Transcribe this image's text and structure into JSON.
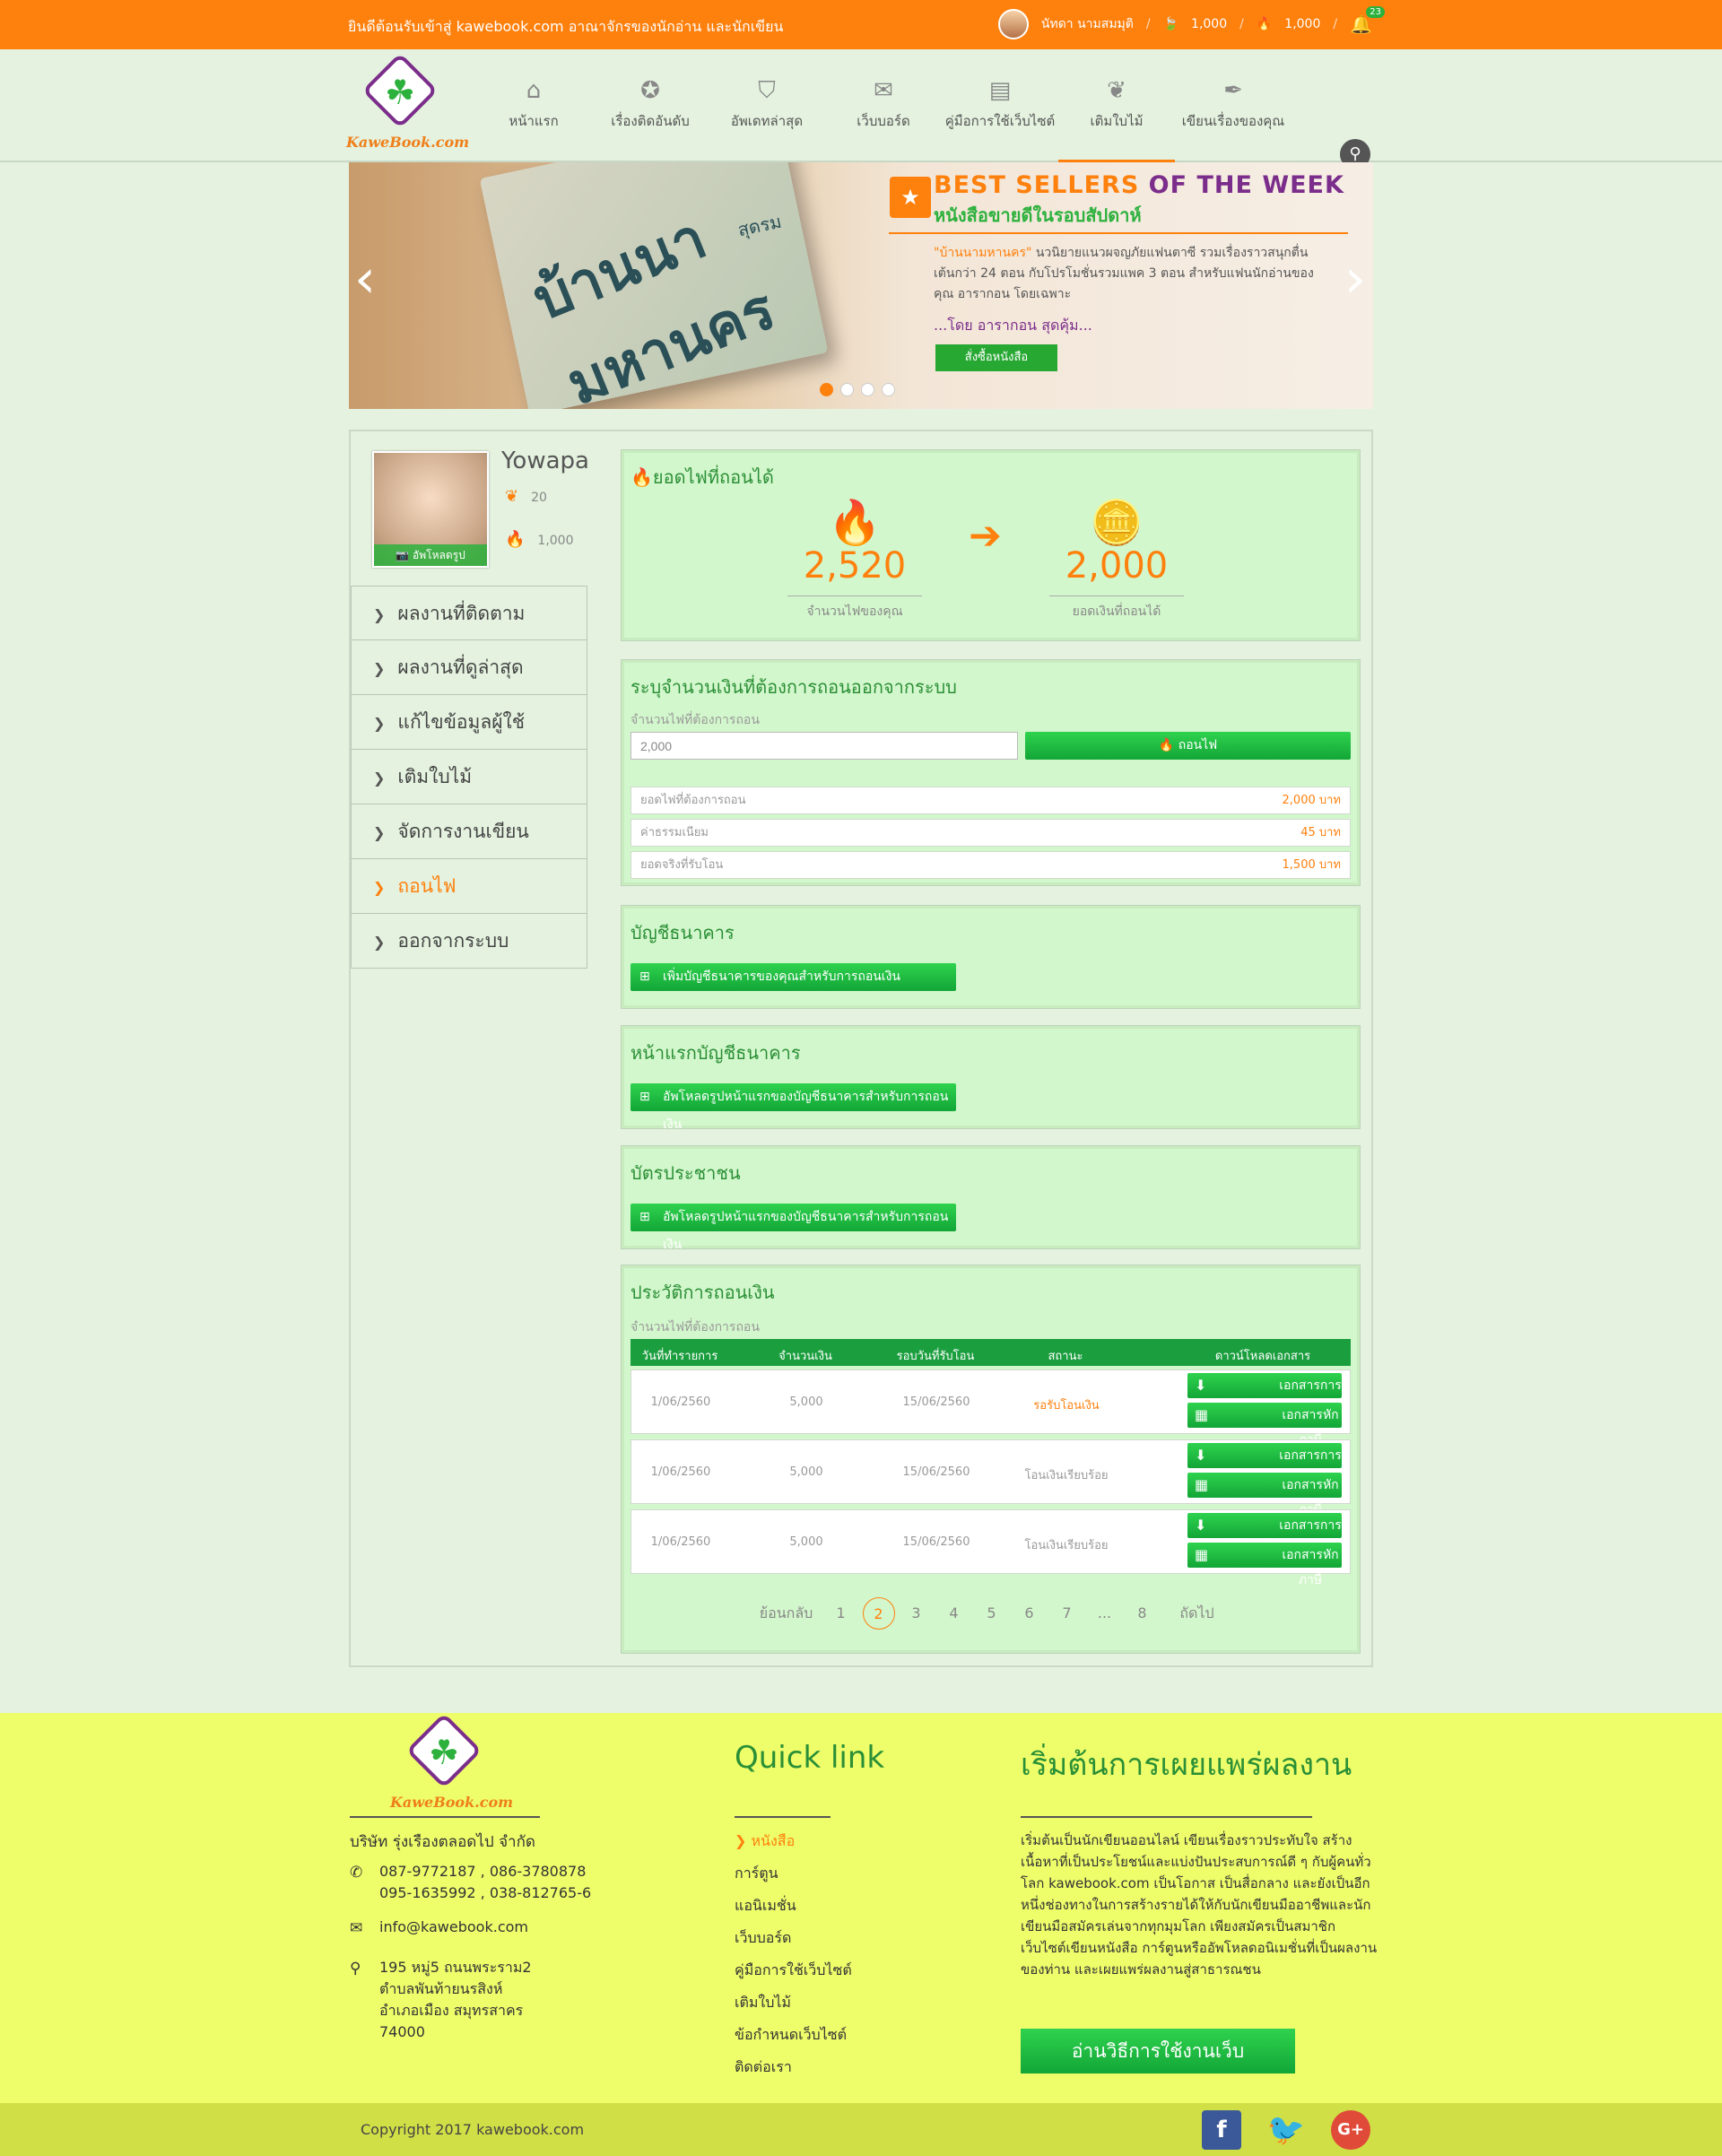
{
  "topbar": {
    "welcome": "ยินดีต้อนรับเข้าสู่ kawebook.com อาณาจักรของนักอ่าน และนักเขียน",
    "user": "นัทดา นามสมมุติ",
    "leaves": "1,000",
    "fire": "1,000",
    "notifications": "23"
  },
  "nav": {
    "logo": "KaweBook.com",
    "items": [
      {
        "label": "หน้าแรก",
        "icon": "home-icon"
      },
      {
        "label": "เรื่องติดอันดับ",
        "icon": "ribbon-icon"
      },
      {
        "label": "อัพเดทล่าสุด",
        "icon": "shield-icon"
      },
      {
        "label": "เว็บบอร์ด",
        "icon": "chat-icon"
      },
      {
        "label": "คู่มือการใช้เว็บไซต์",
        "icon": "book-icon"
      },
      {
        "label": "เติมใบไม้",
        "icon": "leaf-icon"
      },
      {
        "label": "เขียนเรื่องของคุณ",
        "icon": "quill-icon"
      }
    ]
  },
  "banner": {
    "title_a": "BEST SELLERS",
    "title_b": "OF THE WEEK",
    "subtitle": "หนังสือขายดีในรอบสัปดาห์",
    "book_name": "\"บ้านนามหานคร\"",
    "desc": "นวนิยายแนวผจญภัยแฟนตาซี รวมเรื่องราวสนุกตื่นเต้นกว่า 24 ตอน กับโปรโมชั่นรวมแพค 3 ตอน สำหรับแฟนนักอ่านของคุณ อารากอน โดยเฉพาะ",
    "author": "...โดย อารากอน สุดคุ้ม...",
    "button": "สั่งซื้อหนังสือ",
    "cover_title": "บ้านนามหานคร",
    "cover_sub": "สุดรม"
  },
  "profile": {
    "name": "Yowapa",
    "leaves": "20",
    "fire": "1,000",
    "upload": "อัพโหลดรูป"
  },
  "menu": [
    "ผลงานที่ติดตาม",
    "ผลงานที่ดูล่าสุด",
    "แก้ไขข้อมูลผู้ใช้",
    "เติมใบไม้",
    "จัดการงานเขียน",
    "ถอนไฟ",
    "ออกจากระบบ"
  ],
  "withdrawable": {
    "title": "ยอดไฟที่ถอนได้",
    "fire_amount": "2,520",
    "fire_caption": "จำนวนไฟของคุณ",
    "money_amount": "2,000",
    "money_caption": "ยอดเงินที่ถอนได้"
  },
  "withdraw_form": {
    "title": "ระบุจำนวนเงินที่ต้องการถอนออกจากระบบ",
    "label": "จำนวนไฟที่ต้องการถอน",
    "value": "2,000",
    "button": "ถอนไฟ",
    "rows": [
      {
        "label": "ยอดไฟที่ต้องการถอน",
        "value": "2,000 บาท"
      },
      {
        "label": "ค่าธรรมเนียม",
        "value": "45 บาท"
      },
      {
        "label": "ยอดจริงที่รับโอน",
        "value": "1,500 บาท"
      }
    ]
  },
  "bank": {
    "title": "บัญชีธนาคาร",
    "button": "เพิ่มบัญชีธนาคารของคุณสำหรับการถอนเงิน"
  },
  "bank_front": {
    "title": "หน้าแรกบัญชีธนาคาร",
    "button": "อัพโหลดรูปหน้าแรกของบัญชีธนาคารสำหรับการถอนเงิน"
  },
  "idcard": {
    "title": "บัตรประชาชน",
    "button": "อัพโหลดรูปหน้าแรกของบัญชีธนาคารสำหรับการถอนเงิน"
  },
  "history": {
    "title": "ประวัติการถอนเงิน",
    "label": "จำนวนไฟที่ต้องการถอน",
    "headers": [
      "วันที่ทำรายการ",
      "จำนวนเงิน",
      "รอบวันที่รับโอน",
      "สถานะ",
      "ดาวน์โหลดเอกสาร"
    ],
    "doc1": "เอกสารการใบชำระเงิน",
    "doc2": "เอกสารหักภาษี",
    "rows": [
      {
        "date": "1/06/2560",
        "amount": "5,000",
        "round": "15/06/2560",
        "status": "รอรับโอนเงิน"
      },
      {
        "date": "1/06/2560",
        "amount": "5,000",
        "round": "15/06/2560",
        "status": "โอนเงินเรียบร้อย"
      },
      {
        "date": "1/06/2560",
        "amount": "5,000",
        "round": "15/06/2560",
        "status": "โอนเงินเรียบร้อย"
      }
    ],
    "pager": {
      "prev": "ย้อนกลับ",
      "pages": [
        "1",
        "2",
        "3",
        "4",
        "5",
        "6",
        "7",
        "...",
        "8"
      ],
      "current": "2",
      "next": "ถัดไป"
    }
  },
  "footer": {
    "company": "บริษัท รุ่งเรืองตลอดไป จำกัด",
    "phone1": "087-9772187 , 086-3780878",
    "phone2": "095-1635992 , 038-812765-6",
    "email": "info@kawebook.com",
    "address": [
      "195 หมู่5 ถนนพระราม2",
      "ตำบลพันท้ายนรสิงห์",
      "อำเภอเมือง สมุทรสาคร",
      "74000"
    ],
    "quick_title": "Quick link",
    "links": [
      "หนังสือ",
      "การ์ตูน",
      "แอนิเมชั่น",
      "เว็บบอร์ด",
      "คู่มือการใช้เว็บไซต์",
      "เติมใบไม้",
      "ข้อกำหนดเว็บไซต์",
      "ติดต่อเรา"
    ],
    "publish_title": "เริ่มต้นการเผยแพร่ผลงาน",
    "publish_desc": "เริ่มต้นเป็นนักเขียนออนไลน์ เขียนเรื่องราวประทับใจ สร้างเนื้อหาที่เป็นประโยชน์และแบ่งปันประสบการณ์ดี ๆ กับผู้คนทั่วโลก kawebook.com เป็นโอกาส เป็นสื่อกลาง และยังเป็นอีกหนึ่งช่องทางในการสร้างรายได้ให้กับนักเขียนมืออาชีพและนักเขียนมือสมัครเล่นจากทุกมุมโลก เพียงสมัครเป็นสมาชิกเว็บไซต์เขียนหนังสือ การ์ตูนหรืออัพโหลดอนิเมชั่นที่เป็นผลงานของท่าน และเผยแพร่ผลงานสู่สาธารณชน",
    "publish_button": "อ่านวิธีการใช้งานเว็บ",
    "copyright": "Copyright 2017 kawebook.com"
  },
  "colors": {
    "orange": "#fe800d",
    "green": "#2db13d",
    "purple": "#7b2d8b",
    "footer": "#eefd6a"
  }
}
